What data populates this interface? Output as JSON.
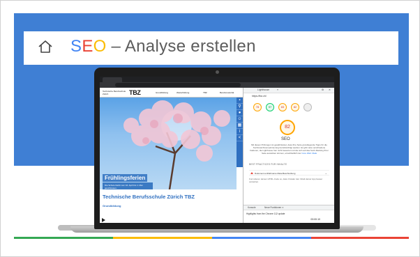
{
  "slide": {
    "title_s": "S",
    "title_e": "E",
    "title_o": "O",
    "title_rest": " – Analyse erstellen"
  },
  "colors": {
    "band": "#3f7fd4",
    "google_blue": "#4285f4",
    "google_red": "#ea4335",
    "google_yellow": "#fbbc05",
    "google_green": "#34a853"
  },
  "website": {
    "logo_text": "Technische Berufsschule Zürich",
    "brand": "TBZ",
    "nav": [
      "Grundbildung",
      "Weiterbildung",
      "TBZ",
      "Berufsmaturität"
    ],
    "hero_title": "Frühlingsferien",
    "hero_sub": "Die Schule bleibt vom 16. April bis 1. Mai geschlossen.",
    "school_name": "Technische Berufsschule Zürich TBZ",
    "section": "Grundbildung"
  },
  "devtools": {
    "tabs": [
      "Lighthouse",
      "»"
    ],
    "url": "https://tbz.ch/",
    "scores": [
      "78",
      "97",
      "83",
      "82"
    ],
    "seo_score": "82",
    "seo_label": "SEO",
    "description": "Mit diesen Prüfungen ist gewährleistet, dass Ihre Seite grundlegende Tipps für die Suchmaschinenoptimierung berücksichtigt werden. Es gibt viele verschiedene Faktoren, die Lighthouse hier nicht bewertet und die sich auf das Such-Ranking Ihrer Seite auswirken können, einschließlich der",
    "description_link": "Core Web Vitals",
    "section_label": "BEST PRACTICES FÜR INHALTE",
    "audit_title": "Dokument enthält keine Meta-Beschreibung",
    "audit_desc": "Formulieren deinen HTML-Code so, dass Crawler den Inhalt deiner App besser verstehen.",
    "console_tabs": [
      "Konsole",
      "Neue Funktionen ✕"
    ],
    "highlight": "Highlights from the Chrome 112 update"
  },
  "player": {
    "time": "00:00:10"
  }
}
